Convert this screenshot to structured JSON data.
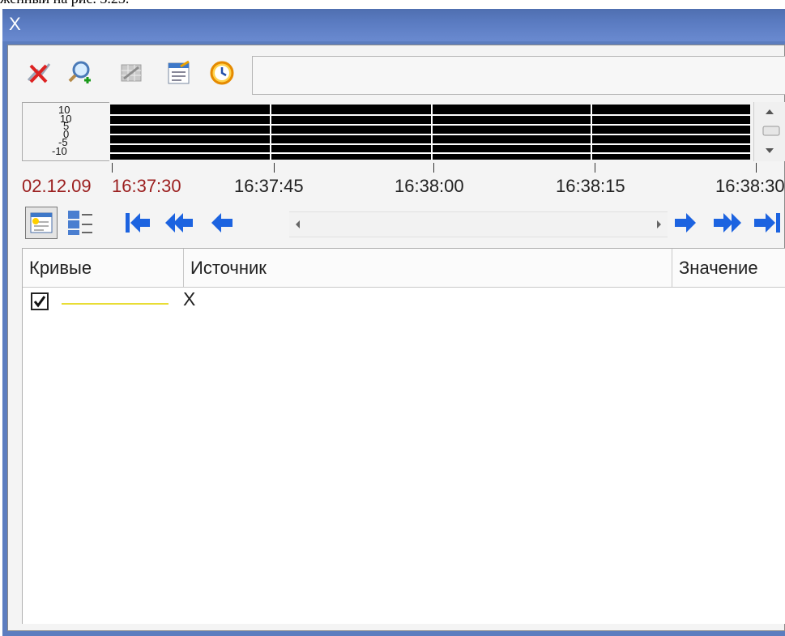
{
  "document": {
    "caption_fragment": "женный на рис. 3.23."
  },
  "window": {
    "title": "X"
  },
  "toolbar": {
    "buttons": [
      {
        "icon": "delete-curve-icon"
      },
      {
        "icon": "zoom-in-icon"
      },
      {
        "icon": "disabled-grid-icon"
      },
      {
        "icon": "properties-icon"
      },
      {
        "icon": "history-clock-icon"
      }
    ],
    "field_value": ""
  },
  "overview": {
    "y_ticks": [
      "10",
      "10",
      "5",
      "0",
      "-5",
      "-10"
    ]
  },
  "time_axis": {
    "date_label": "02.12.09",
    "labels": [
      "16:37:30",
      "16:37:45",
      "16:38:00",
      "16:38:15",
      "16:38:30"
    ]
  },
  "navigation": {
    "left_buttons": [
      "first-icon",
      "fast-back-icon",
      "back-icon"
    ],
    "right_buttons": [
      "forward-icon",
      "fast-forward-icon",
      "last-icon"
    ]
  },
  "table": {
    "columns": [
      "Кривые",
      "Источник",
      "Значение"
    ],
    "rows": [
      {
        "checked": true,
        "curve_color": "#e8dd35",
        "source": "X",
        "value": ""
      }
    ]
  },
  "colors": {
    "title_bar": "#5b7cc2",
    "date_red": "#9b1e1e",
    "nav_arrow_blue": "#1c63e0",
    "curve_yellow": "#e8dd35"
  }
}
